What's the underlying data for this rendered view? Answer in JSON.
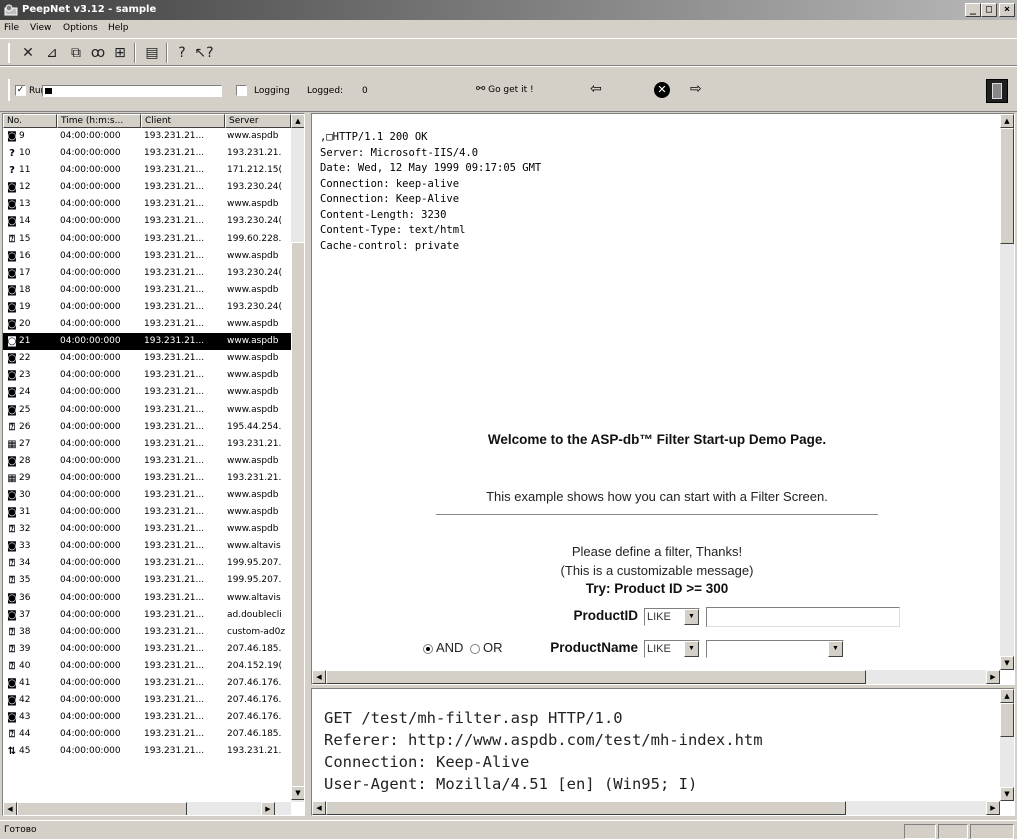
{
  "window": {
    "title": "PeepNet v3.12 - sample",
    "min": "_",
    "max": "□",
    "close": "×"
  },
  "menu": [
    "File",
    "View",
    "Options",
    "Help"
  ],
  "toolbar2": {
    "run_label": "Run",
    "run_checked": "✓",
    "logging_label": "Logging",
    "logged_label": "Logged:",
    "logged_count": "0",
    "go_label": "Go get it !",
    "back_icon": "⇦",
    "forward_icon": "⇨",
    "cancel_icon": "✕",
    "progress": 0.04
  },
  "list": {
    "columns": [
      "No.",
      "Time (h:m:s...",
      "Client",
      "Server"
    ],
    "rows": [
      {
        "icon": "page",
        "no": "9",
        "time": "04:00:00:000",
        "client": "193.231.21...",
        "server": "www.aspdb"
      },
      {
        "icon": "unknown",
        "no": "10",
        "time": "04:00:00:000",
        "client": "193.231.21...",
        "server": "193.231.21."
      },
      {
        "icon": "unknown",
        "no": "11",
        "time": "04:00:00:000",
        "client": "193.231.21...",
        "server": "171.212.15("
      },
      {
        "icon": "page",
        "no": "12",
        "time": "04:00:00:000",
        "client": "193.231.21...",
        "server": "193.230.24("
      },
      {
        "icon": "page",
        "no": "13",
        "time": "04:00:00:000",
        "client": "193.231.21...",
        "server": "www.aspdb"
      },
      {
        "icon": "page",
        "no": "14",
        "time": "04:00:00:000",
        "client": "193.231.21...",
        "server": "193.230.24("
      },
      {
        "icon": "question",
        "no": "15",
        "time": "04:00:00:000",
        "client": "193.231.21...",
        "server": "199.60.228."
      },
      {
        "icon": "page",
        "no": "16",
        "time": "04:00:00:000",
        "client": "193.231.21...",
        "server": "www.aspdb"
      },
      {
        "icon": "page",
        "no": "17",
        "time": "04:00:00:000",
        "client": "193.231.21...",
        "server": "193.230.24("
      },
      {
        "icon": "page",
        "no": "18",
        "time": "04:00:00:000",
        "client": "193.231.21...",
        "server": "www.aspdb"
      },
      {
        "icon": "page",
        "no": "19",
        "time": "04:00:00:000",
        "client": "193.231.21...",
        "server": "193.230.24("
      },
      {
        "icon": "page",
        "no": "20",
        "time": "04:00:00:000",
        "client": "193.231.21...",
        "server": "www.aspdb"
      },
      {
        "icon": "page",
        "no": "21",
        "time": "04:00:00:000",
        "client": "193.231.21...",
        "server": "www.aspdb",
        "selected": true
      },
      {
        "icon": "page",
        "no": "22",
        "time": "04:00:00:000",
        "client": "193.231.21...",
        "server": "www.aspdb"
      },
      {
        "icon": "page",
        "no": "23",
        "time": "04:00:00:000",
        "client": "193.231.21...",
        "server": "www.aspdb"
      },
      {
        "icon": "page",
        "no": "24",
        "time": "04:00:00:000",
        "client": "193.231.21...",
        "server": "www.aspdb"
      },
      {
        "icon": "page",
        "no": "25",
        "time": "04:00:00:000",
        "client": "193.231.21...",
        "server": "www.aspdb"
      },
      {
        "icon": "question",
        "no": "26",
        "time": "04:00:00:000",
        "client": "193.231.21...",
        "server": "195.44.254."
      },
      {
        "icon": "image",
        "no": "27",
        "time": "04:00:00:000",
        "client": "193.231.21...",
        "server": "193.231.21."
      },
      {
        "icon": "page",
        "no": "28",
        "time": "04:00:00:000",
        "client": "193.231.21...",
        "server": "www.aspdb"
      },
      {
        "icon": "image",
        "no": "29",
        "time": "04:00:00:000",
        "client": "193.231.21...",
        "server": "193.231.21."
      },
      {
        "icon": "page",
        "no": "30",
        "time": "04:00:00:000",
        "client": "193.231.21...",
        "server": "www.aspdb"
      },
      {
        "icon": "page",
        "no": "31",
        "time": "04:00:00:000",
        "client": "193.231.21...",
        "server": "www.aspdb"
      },
      {
        "icon": "question",
        "no": "32",
        "time": "04:00:00:000",
        "client": "193.231.21...",
        "server": "www.aspdb"
      },
      {
        "icon": "page",
        "no": "33",
        "time": "04:00:00:000",
        "client": "193.231.21...",
        "server": "www.altavis"
      },
      {
        "icon": "question",
        "no": "34",
        "time": "04:00:00:000",
        "client": "193.231.21...",
        "server": "199.95.207."
      },
      {
        "icon": "question",
        "no": "35",
        "time": "04:00:00:000",
        "client": "193.231.21...",
        "server": "199.95.207."
      },
      {
        "icon": "page",
        "no": "36",
        "time": "04:00:00:000",
        "client": "193.231.21...",
        "server": "www.altavis"
      },
      {
        "icon": "page",
        "no": "37",
        "time": "04:00:00:000",
        "client": "193.231.21...",
        "server": "ad.doublecli"
      },
      {
        "icon": "question",
        "no": "38",
        "time": "04:00:00:000",
        "client": "193.231.21...",
        "server": "custom-ad0z"
      },
      {
        "icon": "question",
        "no": "39",
        "time": "04:00:00:000",
        "client": "193.231.21...",
        "server": "207.46.185."
      },
      {
        "icon": "question",
        "no": "40",
        "time": "04:00:00:000",
        "client": "193.231.21...",
        "server": "204.152.19("
      },
      {
        "icon": "page",
        "no": "41",
        "time": "04:00:00:000",
        "client": "193.231.21...",
        "server": "207.46.176."
      },
      {
        "icon": "page",
        "no": "42",
        "time": "04:00:00:000",
        "client": "193.231.21...",
        "server": "207.46.176."
      },
      {
        "icon": "page",
        "no": "43",
        "time": "04:00:00:000",
        "client": "193.231.21...",
        "server": "207.46.176."
      },
      {
        "icon": "question",
        "no": "44",
        "time": "04:00:00:000",
        "client": "193.231.21...",
        "server": "207.46.185."
      },
      {
        "icon": "transfer",
        "no": "45",
        "time": "04:00:00:000",
        "client": "193.231.21...",
        "server": "193.231.21."
      }
    ]
  },
  "response": {
    "headers": [
      ",□HTTP/1.1 200 OK",
      "Server: Microsoft-IIS/4.0",
      "Date: Wed, 12 May 1999 09:17:05 GMT",
      "Connection: keep-alive",
      "Connection: Keep-Alive",
      "Content-Length: 3230",
      "Content-Type: text/html",
      "Cache-control: private"
    ],
    "welcome": "Welcome to the ASP-db™ Filter Start-up Demo Page.",
    "example": "This example shows how you can start with a Filter Screen.",
    "define": "Please define a filter, Thanks!",
    "custom": "(This is a customizable message)",
    "try": "Try:  Product ID >= 300",
    "field1_label": "ProductID",
    "field1_op": "LIKE",
    "and_label": "AND",
    "or_label": "OR",
    "field2_label": "ProductName",
    "field2_op": "LIKE"
  },
  "request": {
    "lines": [
      "GET /test/mh-filter.asp HTTP/1.0",
      "Referer: http://www.aspdb.com/test/mh-index.htm",
      "Connection: Keep-Alive",
      "User-Agent: Mozilla/4.51 [en] (Win95; I)"
    ]
  },
  "status": {
    "text": "Готово"
  }
}
